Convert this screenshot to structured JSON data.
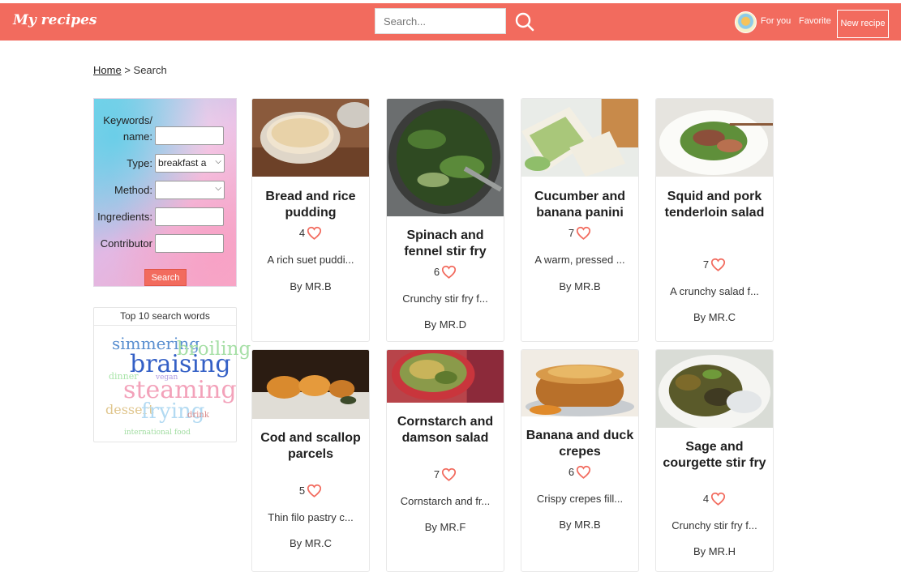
{
  "header": {
    "brand": "My recipes",
    "search_placeholder": "Search...",
    "nav_for_you": "For you",
    "nav_favorite": "Favorite",
    "new_recipe": "New recipe",
    "brand_color": "#f26b5e"
  },
  "breadcrumb": {
    "home": "Home",
    "separator": ">",
    "current": "Search"
  },
  "filters": {
    "keywords_label_line1": "Keywords/",
    "keywords_label_line2": "name:",
    "keywords_value": "",
    "type_label": "Type:",
    "type_value": "breakfast a",
    "method_label": "Method:",
    "method_value": "",
    "ingredients_label": "Ingredients:",
    "ingredients_value": "",
    "contributor_label": "Contributor",
    "contributor_value": "",
    "search_button": "Search"
  },
  "top_words": {
    "title": "Top 10 search words",
    "words": [
      "simmering",
      "broiling",
      "braising",
      "dinner",
      "vegan",
      "steaming",
      "dessert",
      "frying",
      "drink",
      "international food"
    ]
  },
  "recipes": [
    {
      "title": "Bread and rice pudding",
      "likes": "4",
      "description": "A rich suet puddi...",
      "author": "By MR.B",
      "image": "rice-pudding-photo"
    },
    {
      "title": "Spinach and fennel stir fry",
      "likes": "6",
      "description": "Crunchy stir fry f...",
      "author": "By MR.D",
      "image": "stir-fry-pan-photo"
    },
    {
      "title": "Cucumber and banana panini",
      "likes": "7",
      "description": "A warm, pressed ...",
      "author": "By MR.B",
      "image": "sandwich-photo"
    },
    {
      "title": "Squid and pork tenderloin salad",
      "likes": "7",
      "description": "A crunchy salad f...",
      "author": "By MR.C",
      "image": "salad-plate-photo"
    },
    {
      "title": "Cod and scallop parcels",
      "likes": "5",
      "description": "Thin filo pastry c...",
      "author": "By MR.C",
      "image": "scallop-photo"
    },
    {
      "title": "Cornstarch and damson salad",
      "likes": "7",
      "description": "Cornstarch and fr...",
      "author": "By MR.F",
      "image": "grain-salad-photo"
    },
    {
      "title": "Banana and duck crepes",
      "likes": "6",
      "description": "Crispy crepes fill...",
      "author": "By MR.B",
      "image": "pancake-stack-photo"
    },
    {
      "title": "Sage and courgette stir fry",
      "likes": "4",
      "description": "Crunchy stir fry f...",
      "author": "By MR.H",
      "image": "courgette-bowl-photo"
    }
  ]
}
